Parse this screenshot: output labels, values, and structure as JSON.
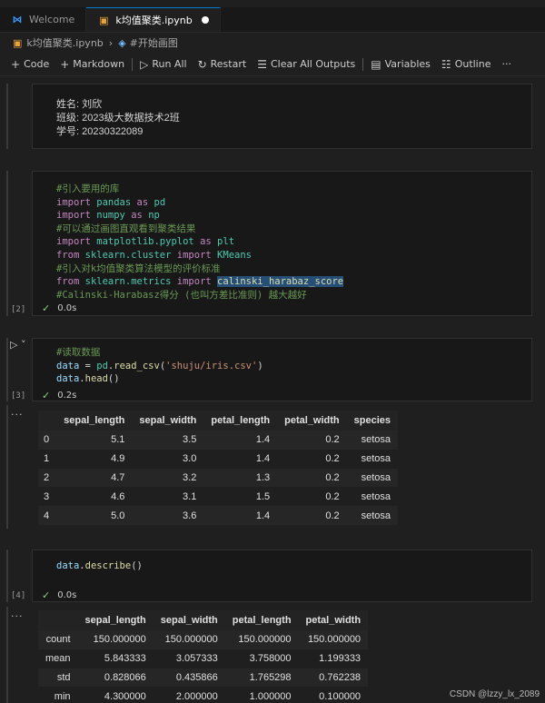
{
  "tabs": [
    {
      "label": "Welcome",
      "active": false,
      "icon": "vscode-icon"
    },
    {
      "label": "k均值聚类.ipynb",
      "active": true,
      "icon": "notebook-icon"
    }
  ],
  "breadcrumb": {
    "file": "k均值聚类.ipynb",
    "section": "#开始画图"
  },
  "toolbar": {
    "code": "Code",
    "markdown": "Markdown",
    "run_all": "Run All",
    "restart": "Restart",
    "clear": "Clear All Outputs",
    "variables": "Variables",
    "outline": "Outline",
    "more": "···"
  },
  "cells": {
    "md1": [
      "姓名: 刘欣",
      "班级: 2023级大数据技术2班",
      "学号: 20230322089"
    ],
    "c2": {
      "count": "[2]",
      "time": "0.0s",
      "lines": {
        "l1": "#引入要用的库",
        "l2a": "import",
        "l2b": "pandas",
        "l2c": "as",
        "l2d": "pd",
        "l3a": "import",
        "l3b": "numpy",
        "l3c": "as",
        "l3d": "np",
        "l4": "#可以通过画图直观看到聚类结果",
        "l5a": "import",
        "l5b": "matplotlib.pyplot",
        "l5c": "as",
        "l5d": "plt",
        "l6a": "from",
        "l6b": "sklearn.cluster",
        "l6c": "import",
        "l6d": "KMeans",
        "l7": "#引入对k均值聚类算法模型的评价标准",
        "l8a": "from",
        "l8b": "sklearn.metrics",
        "l8c": "import",
        "l8d": "calinski_harabaz_score",
        "l9": "#Calinski-Harabasz得分 (也叫方差比准则) 越大越好"
      }
    },
    "c3": {
      "count": "[3]",
      "time": "0.2s",
      "l1": "#读取数据",
      "l2a": "data",
      "l2b": " = ",
      "l2c": "pd",
      "l2d": ".",
      "l2e": "read_csv",
      "l2f": "(",
      "l2g": "'shuju/iris.csv'",
      "l2h": ")",
      "l3a": "data",
      "l3b": ".",
      "l3c": "head",
      "l3d": "()"
    },
    "c4": {
      "count": "[4]",
      "time": "0.0s",
      "l1a": "data",
      "l1b": ".",
      "l1c": "describe",
      "l1d": "()"
    }
  },
  "head_table": {
    "columns": [
      "",
      "sepal_length",
      "sepal_width",
      "petal_length",
      "petal_width",
      "species"
    ],
    "rows": [
      [
        "0",
        "5.1",
        "3.5",
        "1.4",
        "0.2",
        "setosa"
      ],
      [
        "1",
        "4.9",
        "3.0",
        "1.4",
        "0.2",
        "setosa"
      ],
      [
        "2",
        "4.7",
        "3.2",
        "1.3",
        "0.2",
        "setosa"
      ],
      [
        "3",
        "4.6",
        "3.1",
        "1.5",
        "0.2",
        "setosa"
      ],
      [
        "4",
        "5.0",
        "3.6",
        "1.4",
        "0.2",
        "setosa"
      ]
    ]
  },
  "describe_table": {
    "columns": [
      "",
      "sepal_length",
      "sepal_width",
      "petal_length",
      "petal_width"
    ],
    "rows": [
      [
        "count",
        "150.000000",
        "150.000000",
        "150.000000",
        "150.000000"
      ],
      [
        "mean",
        "5.843333",
        "3.057333",
        "3.758000",
        "1.199333"
      ],
      [
        "std",
        "0.828066",
        "0.435866",
        "1.765298",
        "0.762238"
      ],
      [
        "min",
        "4.300000",
        "2.000000",
        "1.000000",
        "0.100000"
      ]
    ]
  },
  "watermark": "CSDN @lzzy_lx_2089",
  "colors": {
    "accent": "#0078d4",
    "success": "#89d185",
    "bg": "#1f1f1f"
  }
}
